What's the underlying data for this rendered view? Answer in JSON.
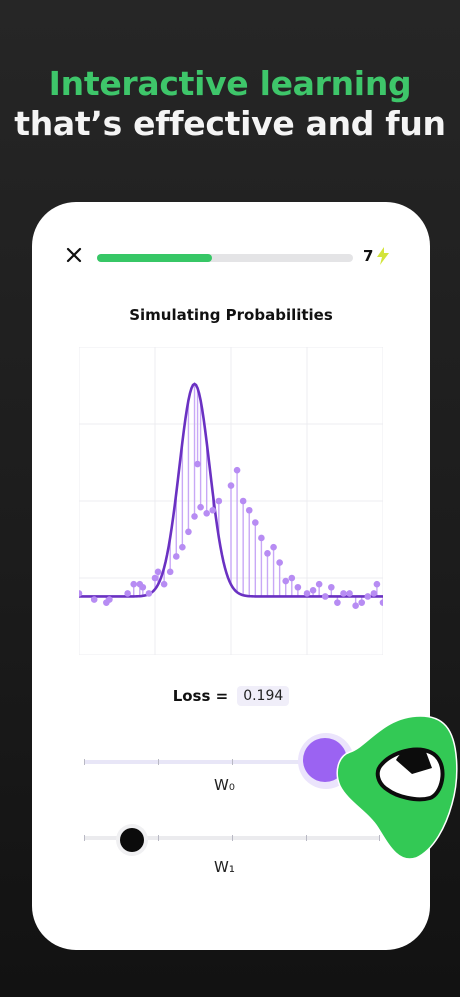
{
  "headline": {
    "line1": "Interactive learning",
    "line2": "that’s effective and fun"
  },
  "lesson": {
    "progress": 0.45,
    "streak_count": "7",
    "title": "Simulating Probabilities"
  },
  "chart_data": {
    "type": "scatter",
    "title": "Simulating Probabilities",
    "xlim": [
      0,
      1
    ],
    "ylim": [
      0,
      1
    ],
    "grid": true,
    "series": [
      {
        "kind": "curve",
        "model": "gaussian",
        "baseline": 0.19,
        "peak": 0.88,
        "center": 0.38,
        "width": 0.05
      },
      {
        "kind": "points",
        "points": [
          [
            0.0,
            0.2
          ],
          [
            0.05,
            0.18
          ],
          [
            0.09,
            0.17
          ],
          [
            0.1,
            0.18
          ],
          [
            0.16,
            0.2
          ],
          [
            0.18,
            0.23
          ],
          [
            0.2,
            0.23
          ],
          [
            0.21,
            0.22
          ],
          [
            0.23,
            0.2
          ],
          [
            0.25,
            0.25
          ],
          [
            0.26,
            0.27
          ],
          [
            0.28,
            0.23
          ],
          [
            0.3,
            0.27
          ],
          [
            0.32,
            0.32
          ],
          [
            0.34,
            0.35
          ],
          [
            0.36,
            0.4
          ],
          [
            0.38,
            0.45
          ],
          [
            0.39,
            0.62
          ],
          [
            0.4,
            0.48
          ],
          [
            0.42,
            0.46
          ],
          [
            0.44,
            0.47
          ],
          [
            0.46,
            0.5
          ],
          [
            0.5,
            0.55
          ],
          [
            0.52,
            0.6
          ],
          [
            0.54,
            0.5
          ],
          [
            0.56,
            0.47
          ],
          [
            0.58,
            0.43
          ],
          [
            0.6,
            0.38
          ],
          [
            0.62,
            0.33
          ],
          [
            0.64,
            0.35
          ],
          [
            0.66,
            0.3
          ],
          [
            0.68,
            0.24
          ],
          [
            0.7,
            0.25
          ],
          [
            0.72,
            0.22
          ],
          [
            0.75,
            0.2
          ],
          [
            0.77,
            0.21
          ],
          [
            0.79,
            0.23
          ],
          [
            0.81,
            0.19
          ],
          [
            0.83,
            0.22
          ],
          [
            0.85,
            0.17
          ],
          [
            0.87,
            0.2
          ],
          [
            0.89,
            0.2
          ],
          [
            0.91,
            0.16
          ],
          [
            0.93,
            0.17
          ],
          [
            0.95,
            0.19
          ],
          [
            0.97,
            0.2
          ],
          [
            0.98,
            0.23
          ],
          [
            1.0,
            0.17
          ]
        ]
      }
    ]
  },
  "loss": {
    "label": "Loss =",
    "value": "0.194"
  },
  "sliders": {
    "w0": {
      "label": "W₀",
      "value": 0.89
    },
    "w1": {
      "label": "W₁",
      "value": 0.16
    }
  },
  "icons": {
    "close": "close-icon",
    "streak": "lightning-bolt-icon",
    "mascot": "green-blob-mascot-icon"
  },
  "colors": {
    "brand_green": "#3ec66a",
    "progress_green": "#37c766",
    "bolt_yellow": "#d3e43b",
    "curve_purple": "#6a31c2",
    "point_purple": "#b78cf3",
    "knob_purple": "#9b63f2"
  }
}
